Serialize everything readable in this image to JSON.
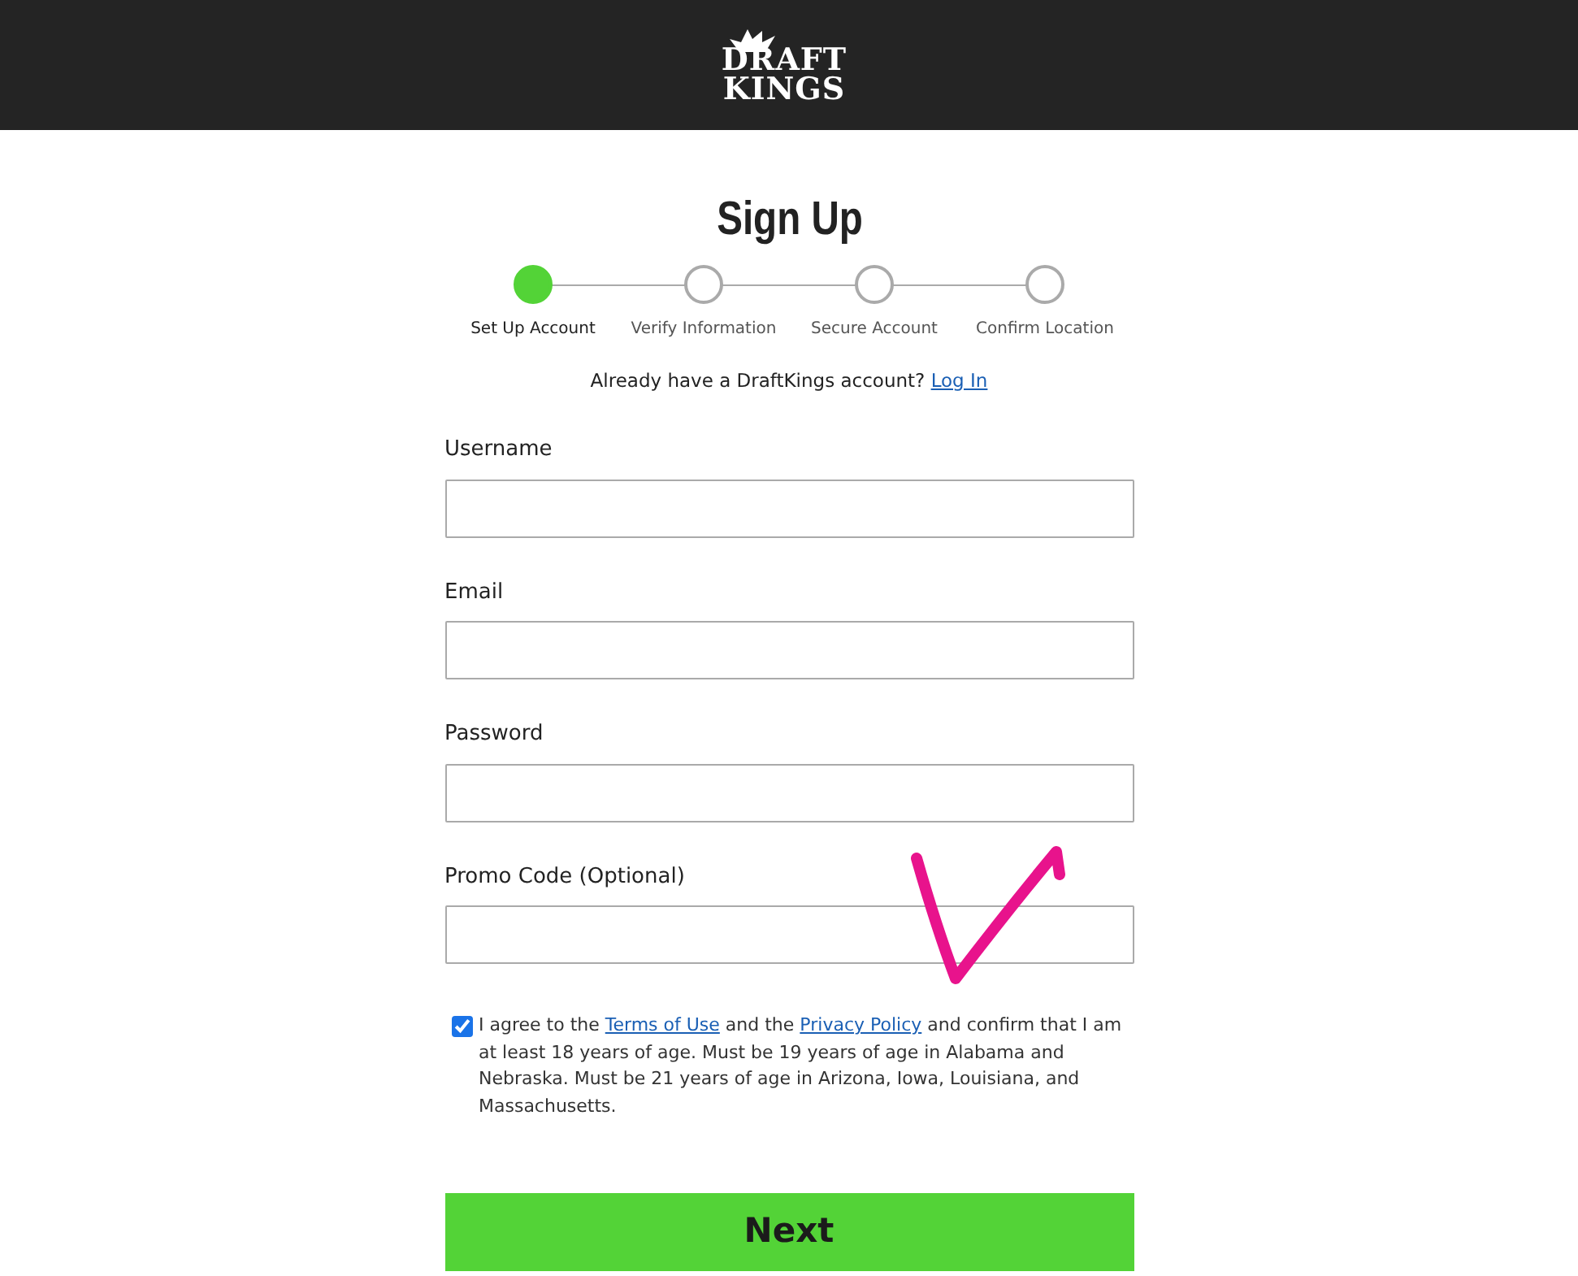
{
  "logo": {
    "lines": [
      "DRAFT",
      "KINGS"
    ]
  },
  "title": "Sign Up",
  "steps": [
    {
      "label": "Set Up Account",
      "selected": true
    },
    {
      "label": "Verify Information",
      "selected": false
    },
    {
      "label": "Secure Account",
      "selected": false
    },
    {
      "label": "Confirm Location",
      "selected": false
    }
  ],
  "login_prompt": {
    "text": "Already have a DraftKings account?",
    "link": "Log In"
  },
  "fields": [
    {
      "label": "Username"
    },
    {
      "label": "Email"
    },
    {
      "label": "Password"
    },
    {
      "label": "Promo Code (Optional)"
    }
  ],
  "consent": {
    "checked": true,
    "parts": [
      {
        "kind": "text",
        "text": "I agree to the "
      },
      {
        "kind": "link",
        "text": "Terms of Use"
      },
      {
        "kind": "text",
        "text": " and the "
      },
      {
        "kind": "link",
        "text": "Privacy Policy"
      },
      {
        "kind": "text",
        "text": " and confirm that I am at least 18 years of age. Must be 19 years of age in Alabama and Nebraska. Must be 21 years of age in Arizona, Iowa, Louisiana, and Massachusetts."
      }
    ]
  },
  "next_button": "Next"
}
